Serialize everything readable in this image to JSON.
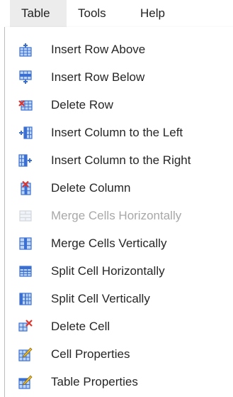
{
  "menubar": {
    "items": [
      {
        "label": "Table",
        "active": true
      },
      {
        "label": "Tools",
        "active": false
      },
      {
        "label": "Help",
        "active": false
      }
    ]
  },
  "menu": {
    "items": [
      {
        "label": "Insert Row Above",
        "icon": "insert-row-above-icon",
        "enabled": true
      },
      {
        "label": "Insert Row Below",
        "icon": "insert-row-below-icon",
        "enabled": true
      },
      {
        "label": "Delete Row",
        "icon": "delete-row-icon",
        "enabled": true
      },
      {
        "label": "Insert Column to the Left",
        "icon": "insert-column-left-icon",
        "enabled": true
      },
      {
        "label": "Insert Column to the Right",
        "icon": "insert-column-right-icon",
        "enabled": true
      },
      {
        "label": "Delete Column",
        "icon": "delete-column-icon",
        "enabled": true
      },
      {
        "label": "Merge Cells Horizontally",
        "icon": "merge-cells-horizontally-icon",
        "enabled": false
      },
      {
        "label": "Merge Cells Vertically",
        "icon": "merge-cells-vertically-icon",
        "enabled": true
      },
      {
        "label": "Split Cell Horizontally",
        "icon": "split-cell-horizontally-icon",
        "enabled": true
      },
      {
        "label": "Split Cell Vertically",
        "icon": "split-cell-vertically-icon",
        "enabled": true
      },
      {
        "label": "Delete Cell",
        "icon": "delete-cell-icon",
        "enabled": true
      },
      {
        "label": "Cell Properties",
        "icon": "cell-properties-icon",
        "enabled": true
      },
      {
        "label": "Table Properties",
        "icon": "table-properties-icon",
        "enabled": true
      }
    ]
  },
  "colors": {
    "icon_blue": "#3a6fd1",
    "icon_light_blue": "#bcd4f6",
    "icon_red": "#e0352b",
    "icon_yellow": "#f2c230",
    "disabled_text": "#a8a8a8"
  }
}
